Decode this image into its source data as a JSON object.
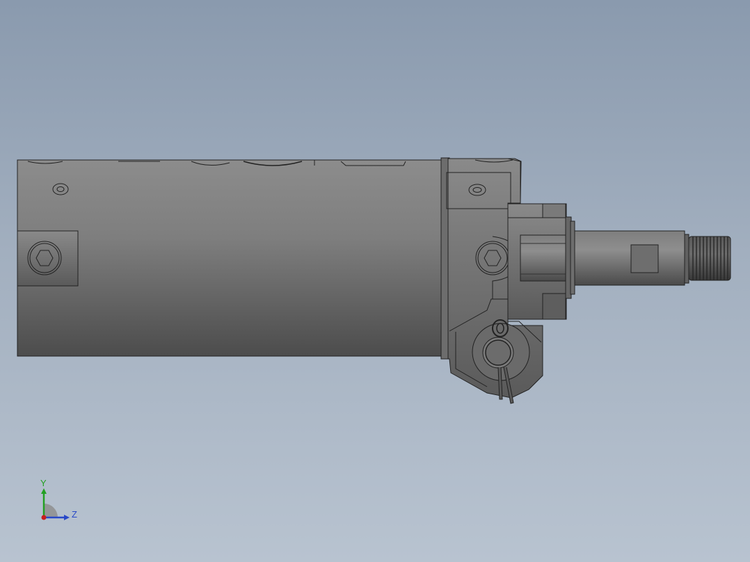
{
  "viewport": {
    "background_top": "#8a9aae",
    "background_bottom": "#b8c3d0",
    "model": "pneumatic-cylinder-with-clevis"
  },
  "triad": {
    "y_label": "Y",
    "z_label": "Z",
    "y_color": "#22a022",
    "z_color": "#2848c8",
    "origin_color": "#c81e1e"
  }
}
